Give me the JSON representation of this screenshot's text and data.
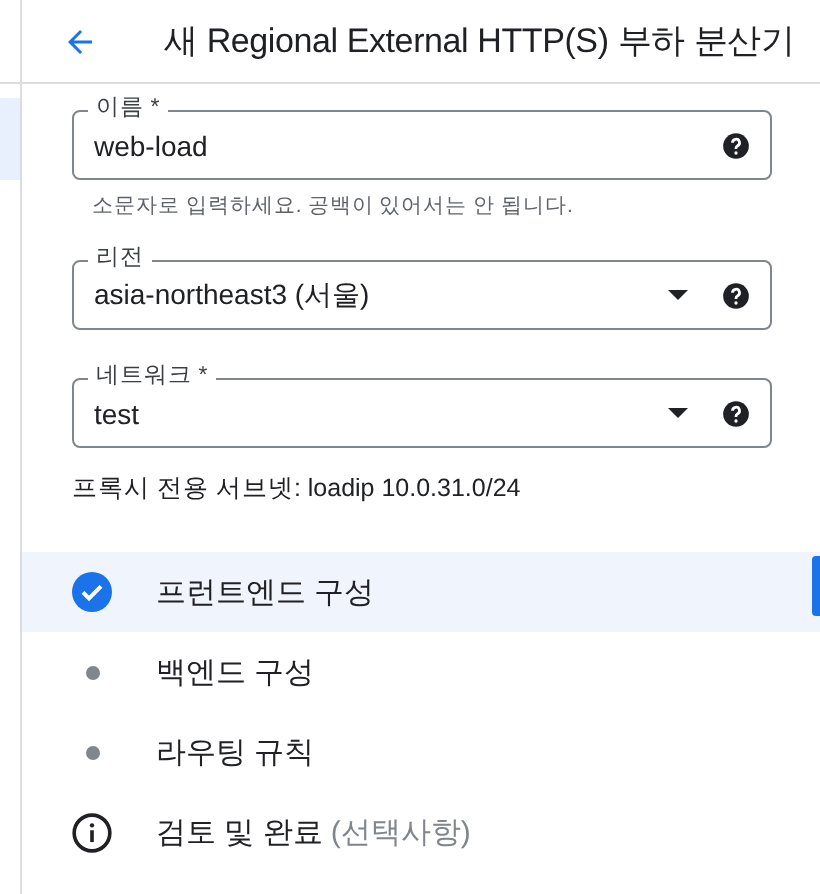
{
  "header": {
    "title": "새 Regional External HTTP(S) 부하 분산기"
  },
  "fields": [
    {
      "kind": "text",
      "label": "이름 *",
      "value": "web-load",
      "hint": "소문자로 입력하세요. 공백이 있어서는 안 됩니다."
    },
    {
      "kind": "select",
      "label": "리전",
      "value": "asia-northeast3 (서울)"
    },
    {
      "kind": "select",
      "label": "네트워크 *",
      "value": "test"
    }
  ],
  "proxy_subnet": "프록시 전용 서브넷: loadip 10.0.31.0/24",
  "steps": [
    {
      "kind": "done",
      "label": "프런트엔드 구성",
      "selected": true
    },
    {
      "kind": "pending",
      "label": "백엔드 구성",
      "selected": false
    },
    {
      "kind": "pending",
      "label": "라우팅 규칙",
      "selected": false
    },
    {
      "kind": "info",
      "label": "검토 및 완료",
      "note": "(선택사항)",
      "selected": false
    }
  ]
}
